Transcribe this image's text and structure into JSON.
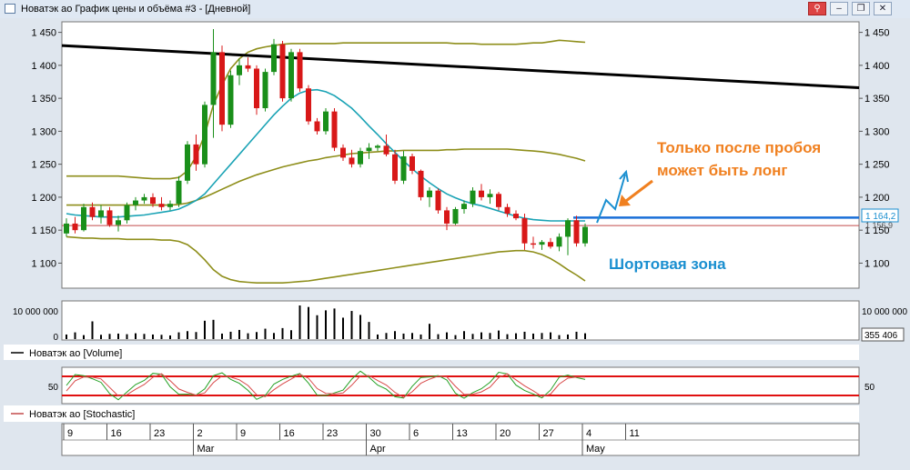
{
  "window": {
    "title": "Новатэк ао График цены и объёма #3 - [Дневной]",
    "buttons": {
      "link": "⚲",
      "minimize": "–",
      "restore": "❐",
      "close": "✕"
    }
  },
  "chart_data": {
    "type": "candlestick",
    "price_panel": {
      "yticks": [
        1100,
        1150,
        1200,
        1250,
        1300,
        1350,
        1400,
        1450
      ],
      "ytick_labels": [
        "1 100",
        "1 150",
        "1 200",
        "1 250",
        "1 300",
        "1 350",
        "1 400",
        "1 450"
      ],
      "ylim": [
        1062,
        1466
      ],
      "last_price_label": "1 164,2",
      "second_price_label": "1 156,9",
      "candles": [
        {
          "o": 1145,
          "h": 1168,
          "l": 1140,
          "c": 1160
        },
        {
          "o": 1160,
          "h": 1170,
          "l": 1145,
          "c": 1150
        },
        {
          "o": 1150,
          "h": 1190,
          "l": 1148,
          "c": 1185
        },
        {
          "o": 1185,
          "h": 1192,
          "l": 1165,
          "c": 1170
        },
        {
          "o": 1170,
          "h": 1188,
          "l": 1160,
          "c": 1180
        },
        {
          "o": 1180,
          "h": 1185,
          "l": 1155,
          "c": 1158
        },
        {
          "o": 1158,
          "h": 1172,
          "l": 1148,
          "c": 1165
        },
        {
          "o": 1165,
          "h": 1192,
          "l": 1160,
          "c": 1188
        },
        {
          "o": 1188,
          "h": 1200,
          "l": 1180,
          "c": 1195
        },
        {
          "o": 1195,
          "h": 1205,
          "l": 1190,
          "c": 1200
        },
        {
          "o": 1200,
          "h": 1206,
          "l": 1185,
          "c": 1190
        },
        {
          "o": 1190,
          "h": 1200,
          "l": 1180,
          "c": 1185
        },
        {
          "o": 1185,
          "h": 1195,
          "l": 1180,
          "c": 1190
        },
        {
          "o": 1190,
          "h": 1232,
          "l": 1185,
          "c": 1225
        },
        {
          "o": 1225,
          "h": 1285,
          "l": 1220,
          "c": 1280
        },
        {
          "o": 1280,
          "h": 1295,
          "l": 1240,
          "c": 1250
        },
        {
          "o": 1250,
          "h": 1345,
          "l": 1245,
          "c": 1340
        },
        {
          "o": 1340,
          "h": 1455,
          "l": 1290,
          "c": 1420
        },
        {
          "o": 1420,
          "h": 1430,
          "l": 1300,
          "c": 1310
        },
        {
          "o": 1310,
          "h": 1392,
          "l": 1305,
          "c": 1385
        },
        {
          "o": 1385,
          "h": 1410,
          "l": 1370,
          "c": 1400
        },
        {
          "o": 1400,
          "h": 1412,
          "l": 1390,
          "c": 1395
        },
        {
          "o": 1395,
          "h": 1400,
          "l": 1325,
          "c": 1335
        },
        {
          "o": 1335,
          "h": 1395,
          "l": 1330,
          "c": 1390
        },
        {
          "o": 1390,
          "h": 1440,
          "l": 1385,
          "c": 1432
        },
        {
          "o": 1432,
          "h": 1437,
          "l": 1345,
          "c": 1350
        },
        {
          "o": 1350,
          "h": 1425,
          "l": 1345,
          "c": 1420
        },
        {
          "o": 1420,
          "h": 1425,
          "l": 1360,
          "c": 1365
        },
        {
          "o": 1365,
          "h": 1370,
          "l": 1310,
          "c": 1315
        },
        {
          "o": 1315,
          "h": 1320,
          "l": 1295,
          "c": 1300
        },
        {
          "o": 1300,
          "h": 1335,
          "l": 1295,
          "c": 1330
        },
        {
          "o": 1330,
          "h": 1335,
          "l": 1270,
          "c": 1275
        },
        {
          "o": 1275,
          "h": 1280,
          "l": 1255,
          "c": 1260
        },
        {
          "o": 1260,
          "h": 1272,
          "l": 1245,
          "c": 1250
        },
        {
          "o": 1250,
          "h": 1275,
          "l": 1245,
          "c": 1270
        },
        {
          "o": 1270,
          "h": 1282,
          "l": 1258,
          "c": 1275
        },
        {
          "o": 1275,
          "h": 1280,
          "l": 1270,
          "c": 1278
        },
        {
          "o": 1278,
          "h": 1295,
          "l": 1262,
          "c": 1265
        },
        {
          "o": 1265,
          "h": 1272,
          "l": 1220,
          "c": 1225
        },
        {
          "o": 1225,
          "h": 1270,
          "l": 1220,
          "c": 1262
        },
        {
          "o": 1262,
          "h": 1266,
          "l": 1235,
          "c": 1240
        },
        {
          "o": 1240,
          "h": 1242,
          "l": 1195,
          "c": 1200
        },
        {
          "o": 1200,
          "h": 1215,
          "l": 1185,
          "c": 1210
        },
        {
          "o": 1210,
          "h": 1213,
          "l": 1175,
          "c": 1180
        },
        {
          "o": 1180,
          "h": 1185,
          "l": 1150,
          "c": 1160
        },
        {
          "o": 1160,
          "h": 1185,
          "l": 1158,
          "c": 1182
        },
        {
          "o": 1182,
          "h": 1195,
          "l": 1175,
          "c": 1190
        },
        {
          "o": 1190,
          "h": 1215,
          "l": 1185,
          "c": 1210
        },
        {
          "o": 1210,
          "h": 1220,
          "l": 1195,
          "c": 1200
        },
        {
          "o": 1200,
          "h": 1212,
          "l": 1190,
          "c": 1205
        },
        {
          "o": 1205,
          "h": 1208,
          "l": 1180,
          "c": 1185
        },
        {
          "o": 1185,
          "h": 1190,
          "l": 1170,
          "c": 1175
        },
        {
          "o": 1175,
          "h": 1180,
          "l": 1165,
          "c": 1168
        },
        {
          "o": 1168,
          "h": 1175,
          "l": 1120,
          "c": 1130
        },
        {
          "o": 1130,
          "h": 1140,
          "l": 1122,
          "c": 1128
        },
        {
          "o": 1128,
          "h": 1135,
          "l": 1120,
          "c": 1132
        },
        {
          "o": 1132,
          "h": 1138,
          "l": 1122,
          "c": 1125
        },
        {
          "o": 1125,
          "h": 1145,
          "l": 1118,
          "c": 1140
        },
        {
          "o": 1140,
          "h": 1168,
          "l": 1112,
          "c": 1165
        },
        {
          "o": 1165,
          "h": 1172,
          "l": 1125,
          "c": 1130
        },
        {
          "o": 1130,
          "h": 1160,
          "l": 1125,
          "c": 1155
        }
      ],
      "moving_average": [
        1175,
        1173,
        1172,
        1171,
        1170,
        1170,
        1170,
        1171,
        1172,
        1173,
        1175,
        1177,
        1179,
        1182,
        1188,
        1195,
        1205,
        1220,
        1235,
        1250,
        1265,
        1280,
        1295,
        1310,
        1325,
        1338,
        1350,
        1358,
        1362,
        1363,
        1360,
        1354,
        1345,
        1335,
        1322,
        1308,
        1295,
        1281,
        1268,
        1255,
        1243,
        1232,
        1222,
        1213,
        1205,
        1199,
        1194,
        1190,
        1187,
        1183,
        1179,
        1175,
        1171,
        1168,
        1166,
        1165,
        1164,
        1164,
        1164,
        1164,
        1164
      ],
      "bollinger_upper": [
        1232,
        1232,
        1232,
        1232,
        1232,
        1232,
        1232,
        1231,
        1230,
        1229,
        1228,
        1228,
        1228,
        1230,
        1240,
        1262,
        1295,
        1340,
        1370,
        1395,
        1410,
        1420,
        1425,
        1428,
        1430,
        1432,
        1433,
        1433,
        1433,
        1433,
        1433,
        1433,
        1434,
        1434,
        1434,
        1434,
        1434,
        1434,
        1434,
        1434,
        1434,
        1434,
        1434,
        1434,
        1434,
        1433,
        1433,
        1433,
        1432,
        1432,
        1432,
        1432,
        1432,
        1433,
        1434,
        1434,
        1436,
        1438,
        1437,
        1436,
        1435
      ],
      "bollinger_middle": [
        1188,
        1188,
        1188,
        1188,
        1188,
        1188,
        1188,
        1188,
        1188,
        1188,
        1188,
        1188,
        1188,
        1189,
        1191,
        1195,
        1200,
        1206,
        1212,
        1218,
        1224,
        1229,
        1234,
        1238,
        1242,
        1246,
        1249,
        1252,
        1255,
        1257,
        1260,
        1262,
        1264,
        1266,
        1267,
        1268,
        1269,
        1270,
        1270,
        1271,
        1271,
        1271,
        1271,
        1271,
        1272,
        1272,
        1273,
        1273,
        1273,
        1273,
        1273,
        1273,
        1272,
        1271,
        1270,
        1269,
        1267,
        1265,
        1262,
        1259,
        1255
      ],
      "bollinger_lower": [
        1140,
        1139,
        1138,
        1138,
        1137,
        1137,
        1137,
        1136,
        1136,
        1136,
        1136,
        1135,
        1135,
        1133,
        1128,
        1118,
        1105,
        1090,
        1080,
        1075,
        1072,
        1071,
        1070,
        1070,
        1070,
        1070,
        1071,
        1072,
        1073,
        1075,
        1077,
        1079,
        1081,
        1083,
        1085,
        1087,
        1089,
        1091,
        1093,
        1095,
        1097,
        1099,
        1101,
        1103,
        1105,
        1107,
        1109,
        1111,
        1113,
        1115,
        1117,
        1118,
        1119,
        1119,
        1117,
        1113,
        1107,
        1099,
        1090,
        1082,
        1073
      ],
      "trendline_black": {
        "start": 1430,
        "end": 1366
      },
      "resistance_blue": 1169,
      "price_line_red": 1157
    },
    "volume_panel": {
      "ytick_label_top": "10 000 000",
      "ytick_label_zero": "0",
      "right_label_top": "10 000 000",
      "last_volume_label": "355 406",
      "ymax": 11000000,
      "volumes": [
        1500000,
        2200000,
        1300000,
        5800000,
        1400000,
        1700000,
        1800000,
        1600000,
        1900000,
        1700000,
        1500000,
        1400000,
        1200000,
        2200000,
        2600000,
        2300000,
        6000000,
        6300000,
        1800000,
        2400000,
        3000000,
        1900000,
        2300000,
        3400000,
        2000000,
        3600000,
        2900000,
        11000000,
        10500000,
        7800000,
        9400000,
        10000000,
        7000000,
        9200000,
        7900000,
        5600000,
        1500000,
        2000000,
        2600000,
        1800000,
        2000000,
        1500000,
        5000000,
        1600000,
        2200000,
        1300000,
        2600000,
        1700000,
        2200000,
        2000000,
        2800000,
        1600000,
        1900000,
        2400000,
        1800000,
        2000000,
        2200000,
        1300000,
        1500000,
        2400000,
        1900000
      ]
    },
    "stochastic_panel": {
      "ytick_label": "50",
      "right_label": "50",
      "ylim": [
        0,
        100
      ]
    },
    "legend": {
      "volume": "Новатэк ао [Volume]",
      "stochastic": "Новатэк ао [Stochastic]"
    },
    "x_axis": {
      "day_ticks": [
        "9",
        "16",
        "23",
        "2",
        "9",
        "16",
        "23",
        "30",
        "6",
        "13",
        "20",
        "27",
        "4",
        "11"
      ],
      "day_tick_index": [
        0,
        5,
        10,
        15,
        20,
        25,
        30,
        35,
        40,
        45,
        50,
        55,
        60,
        65
      ],
      "months": [
        "Mar",
        "Apr",
        "May"
      ],
      "month_tick_index": [
        15,
        35,
        60
      ]
    },
    "annotations": {
      "long_text_line1": "Только после пробоя",
      "long_text_line2": "может быть лонг",
      "short_text": "Шортовая зона"
    },
    "colors": {
      "up": "#1a8f1a",
      "down": "#d81818",
      "moving_average": "#1aa3b5",
      "bollinger": "#8e8e1a",
      "trendline": "#000000",
      "resistance": "#1a6fd8",
      "price_line": "#c24a4a",
      "stoch_bounds": "#e01010",
      "annotation_orange": "#f08020",
      "annotation_blue": "#1a8fd0"
    }
  }
}
